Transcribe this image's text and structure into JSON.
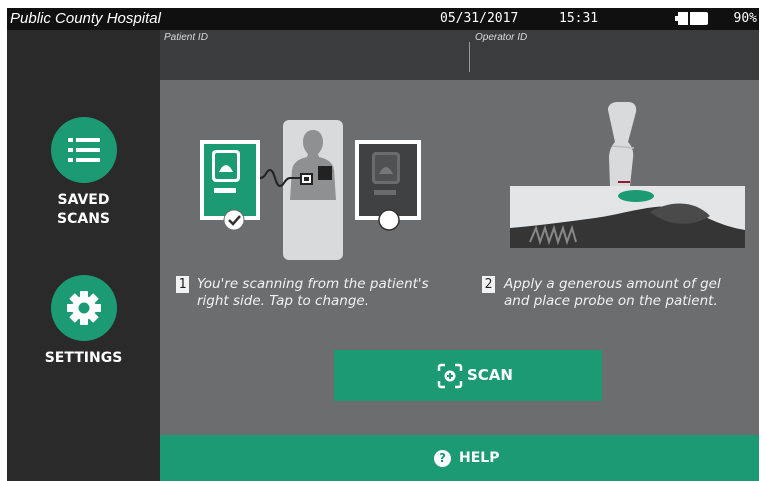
{
  "status_bar": {
    "hospital": "Public County Hospital",
    "date": "05/31/2017",
    "time": "15:31",
    "battery_percent": "90%",
    "battery_level": 0.9
  },
  "id_bar": {
    "patient_id_label": "Patient ID",
    "patient_id_value": "",
    "operator_id_label": "Operator ID",
    "operator_id_value": ""
  },
  "sidebar": {
    "saved_scans": {
      "label_line1": "SAVED",
      "label_line2": "SCANS",
      "icon": "list-icon"
    },
    "settings": {
      "label": "SETTINGS",
      "icon": "gear-icon"
    }
  },
  "steps": [
    {
      "number": "1",
      "line1": "You're scanning from the patient's",
      "line2": "right side. Tap to change."
    },
    {
      "number": "2",
      "line1": "Apply a generous amount of gel",
      "line2": "and place probe on the patient."
    }
  ],
  "scan_button": {
    "label": "SCAN",
    "icon": "scan-target-icon"
  },
  "help_button": {
    "label": "HELP",
    "icon": "help-icon",
    "icon_glyph": "?"
  },
  "colors": {
    "accent": "#1b9a73",
    "panel": "#6c6d6e",
    "sidebar": "#2a2a2a",
    "status_bar": "#101010"
  }
}
